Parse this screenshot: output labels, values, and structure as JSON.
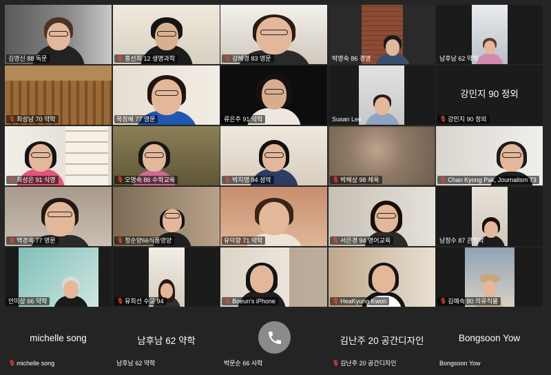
{
  "window": {
    "title": "Zoom Gallery View"
  },
  "participants": [
    {
      "id": "p1",
      "name": "김영신 88 독문",
      "muted": false
    },
    {
      "id": "p2",
      "name": "홍선희 12 생명과학",
      "muted": true
    },
    {
      "id": "p3",
      "name": "강혜경 83 영문",
      "muted": true
    },
    {
      "id": "p4",
      "name": "박영숙 86 경영",
      "muted": false
    },
    {
      "id": "p5",
      "name": "남후남 62 약학",
      "muted": false
    },
    {
      "id": "p6",
      "name": "최성남 70 약학",
      "muted": true
    },
    {
      "id": "p7",
      "name": "목정혜 77 영문",
      "muted": false
    },
    {
      "id": "p8",
      "name": "류은주 91 약학",
      "muted": false,
      "active_speaker": true
    },
    {
      "id": "p9",
      "name": "Susan Lee",
      "muted": false
    },
    {
      "id": "p10",
      "name": "강민지 90 정외",
      "muted": true,
      "display_name": "강민지 90 정외"
    },
    {
      "id": "p11",
      "name": "최성은 91 식영",
      "muted": true
    },
    {
      "id": "p12",
      "name": "오명숙 86 수학교육",
      "muted": true
    },
    {
      "id": "p13",
      "name": "박지영 94 성악",
      "muted": true
    },
    {
      "id": "p14",
      "name": "박혜상 98 체육",
      "muted": true
    },
    {
      "id": "p15",
      "name": "Chan Kyong Pak, Journalism 73",
      "muted": true
    },
    {
      "id": "p16",
      "name": "백경옥 77 영문",
      "muted": true
    },
    {
      "id": "p17",
      "name": "정순양66식품영양",
      "muted": true
    },
    {
      "id": "p18",
      "name": "유덕향 71 약학",
      "muted": false
    },
    {
      "id": "p19",
      "name": "서은경 94 영어교육",
      "muted": true
    },
    {
      "id": "p20",
      "name": "남정수 87 관현악",
      "muted": false
    },
    {
      "id": "p21",
      "name": "안미상 66 약학",
      "muted": false
    },
    {
      "id": "p22",
      "name": "유희선 수교 94",
      "muted": true
    },
    {
      "id": "p23",
      "name": "Boeun's iPhone",
      "muted": true
    },
    {
      "id": "p24",
      "name": "HeaKyung Kwon",
      "muted": true
    },
    {
      "id": "p25",
      "name": "김예숙 80 의류직물",
      "muted": true
    },
    {
      "id": "p26",
      "name": "michelle song",
      "muted": true,
      "display_name": "michelle song"
    },
    {
      "id": "p27",
      "name": "남후남 62 약학",
      "muted": false,
      "display_name": "남후남 62 약학"
    },
    {
      "id": "p28",
      "name": "박문순 66 사학",
      "muted": false
    },
    {
      "id": "p29",
      "name": "김난주 20 공간디자인",
      "muted": true,
      "display_name": "김난주 20 공간디자인"
    },
    {
      "id": "p30",
      "name": "Bongsoon Yow",
      "muted": false,
      "display_name": "Bongsoon Yow"
    }
  ],
  "controls": {
    "call_icon": "phone-icon"
  },
  "colors": {
    "active_border": "#3fc23f",
    "mute": "#e5453a",
    "background": "#252525"
  }
}
